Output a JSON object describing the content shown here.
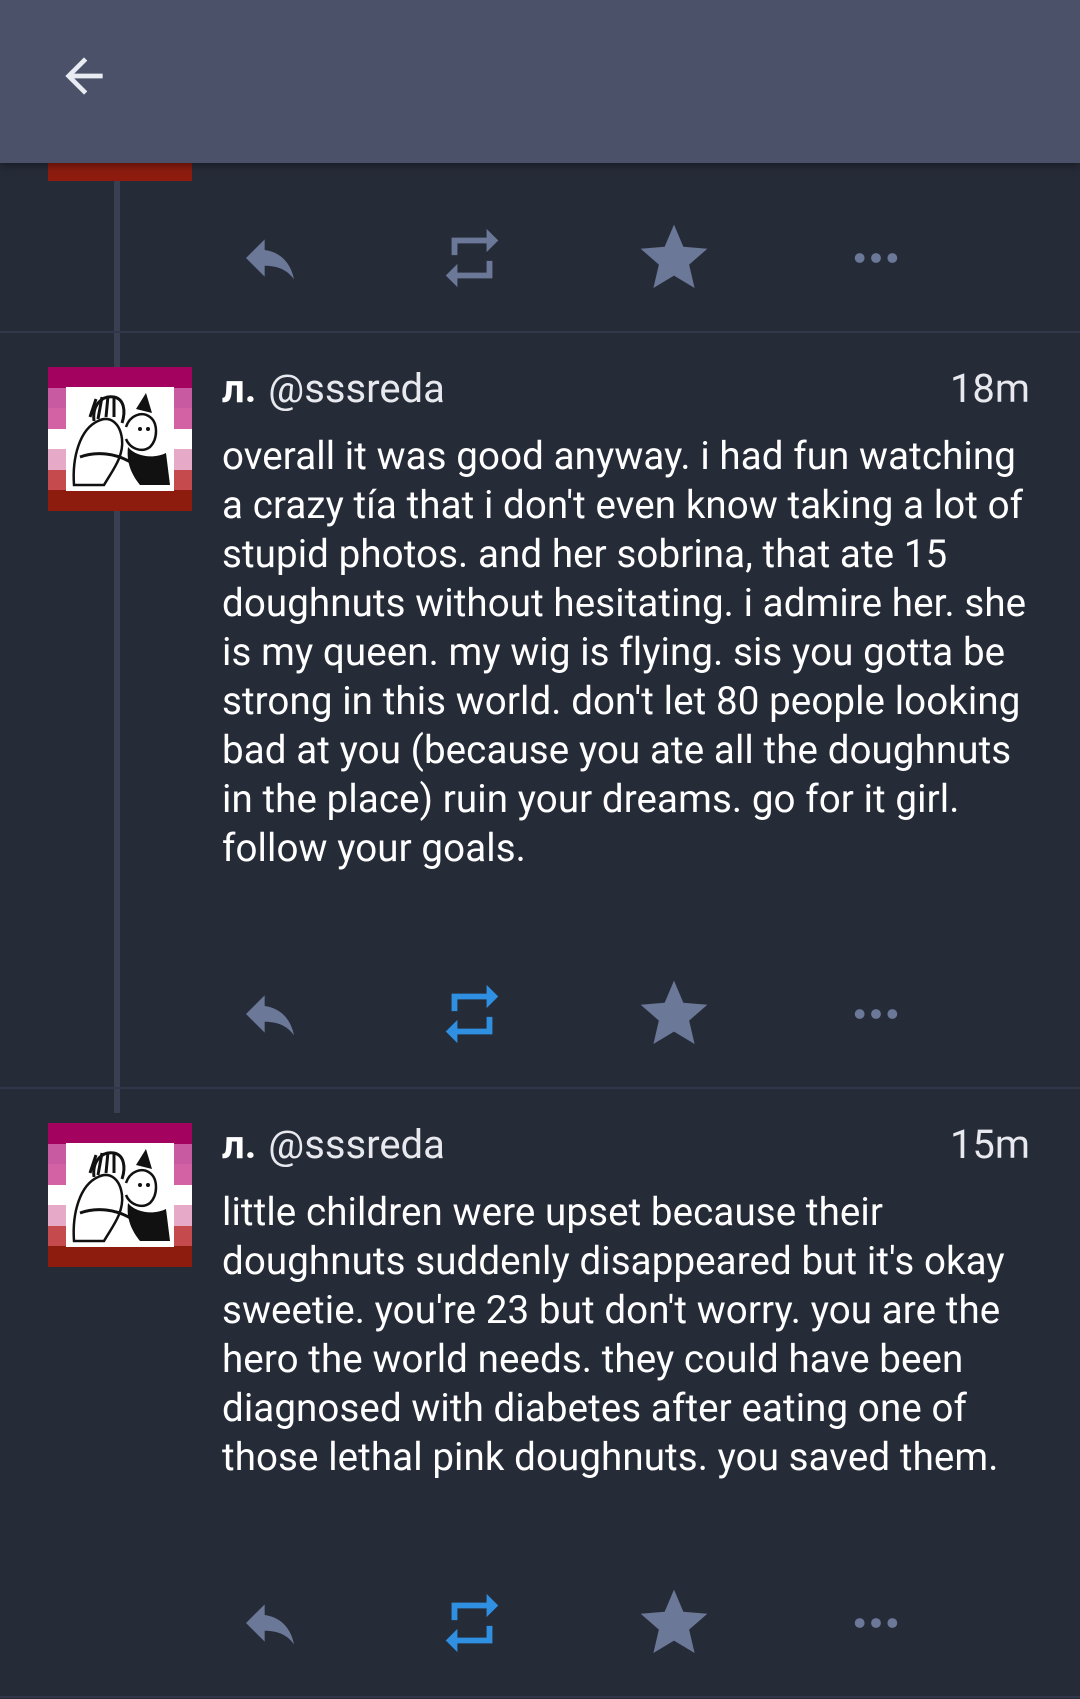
{
  "header": {
    "back_icon": "arrow-left-icon",
    "background": "#4a5168"
  },
  "colors": {
    "background": "#262b38",
    "action_icon": "#6b7898",
    "retweet_active": "#2f8fe0"
  },
  "actions": {
    "reply_icon": "reply-icon",
    "retweet_icon": "retweet-icon",
    "favorite_icon": "star-icon",
    "more_icon": "more-horizontal-icon"
  },
  "tweets": [
    {
      "display_name": "л.",
      "handle": "@sssreda",
      "time": "18m",
      "text": "overall it was good anyway. i had fun watching a crazy tía that i don't even know taking a lot of stupid photos. and her sobrina, that ate 15 doughnuts without hesitating. i admire her. she is my queen. my wig is flying. sis you gotta be strong in this world. don't let 80 people looking bad at you (because you ate all the doughnuts in the place) ruin your dreams. go for it girl. follow your goals.",
      "retweeted": true
    },
    {
      "display_name": "л.",
      "handle": "@sssreda",
      "time": "15m",
      "text": "little children were upset because their doughnuts suddenly disappeared but it's okay sweetie. you're 23 but don't worry. you are the hero the world needs. they could have been diagnosed with diabetes after eating one of those lethal pink doughnuts. you saved them.",
      "retweeted": true
    }
  ]
}
